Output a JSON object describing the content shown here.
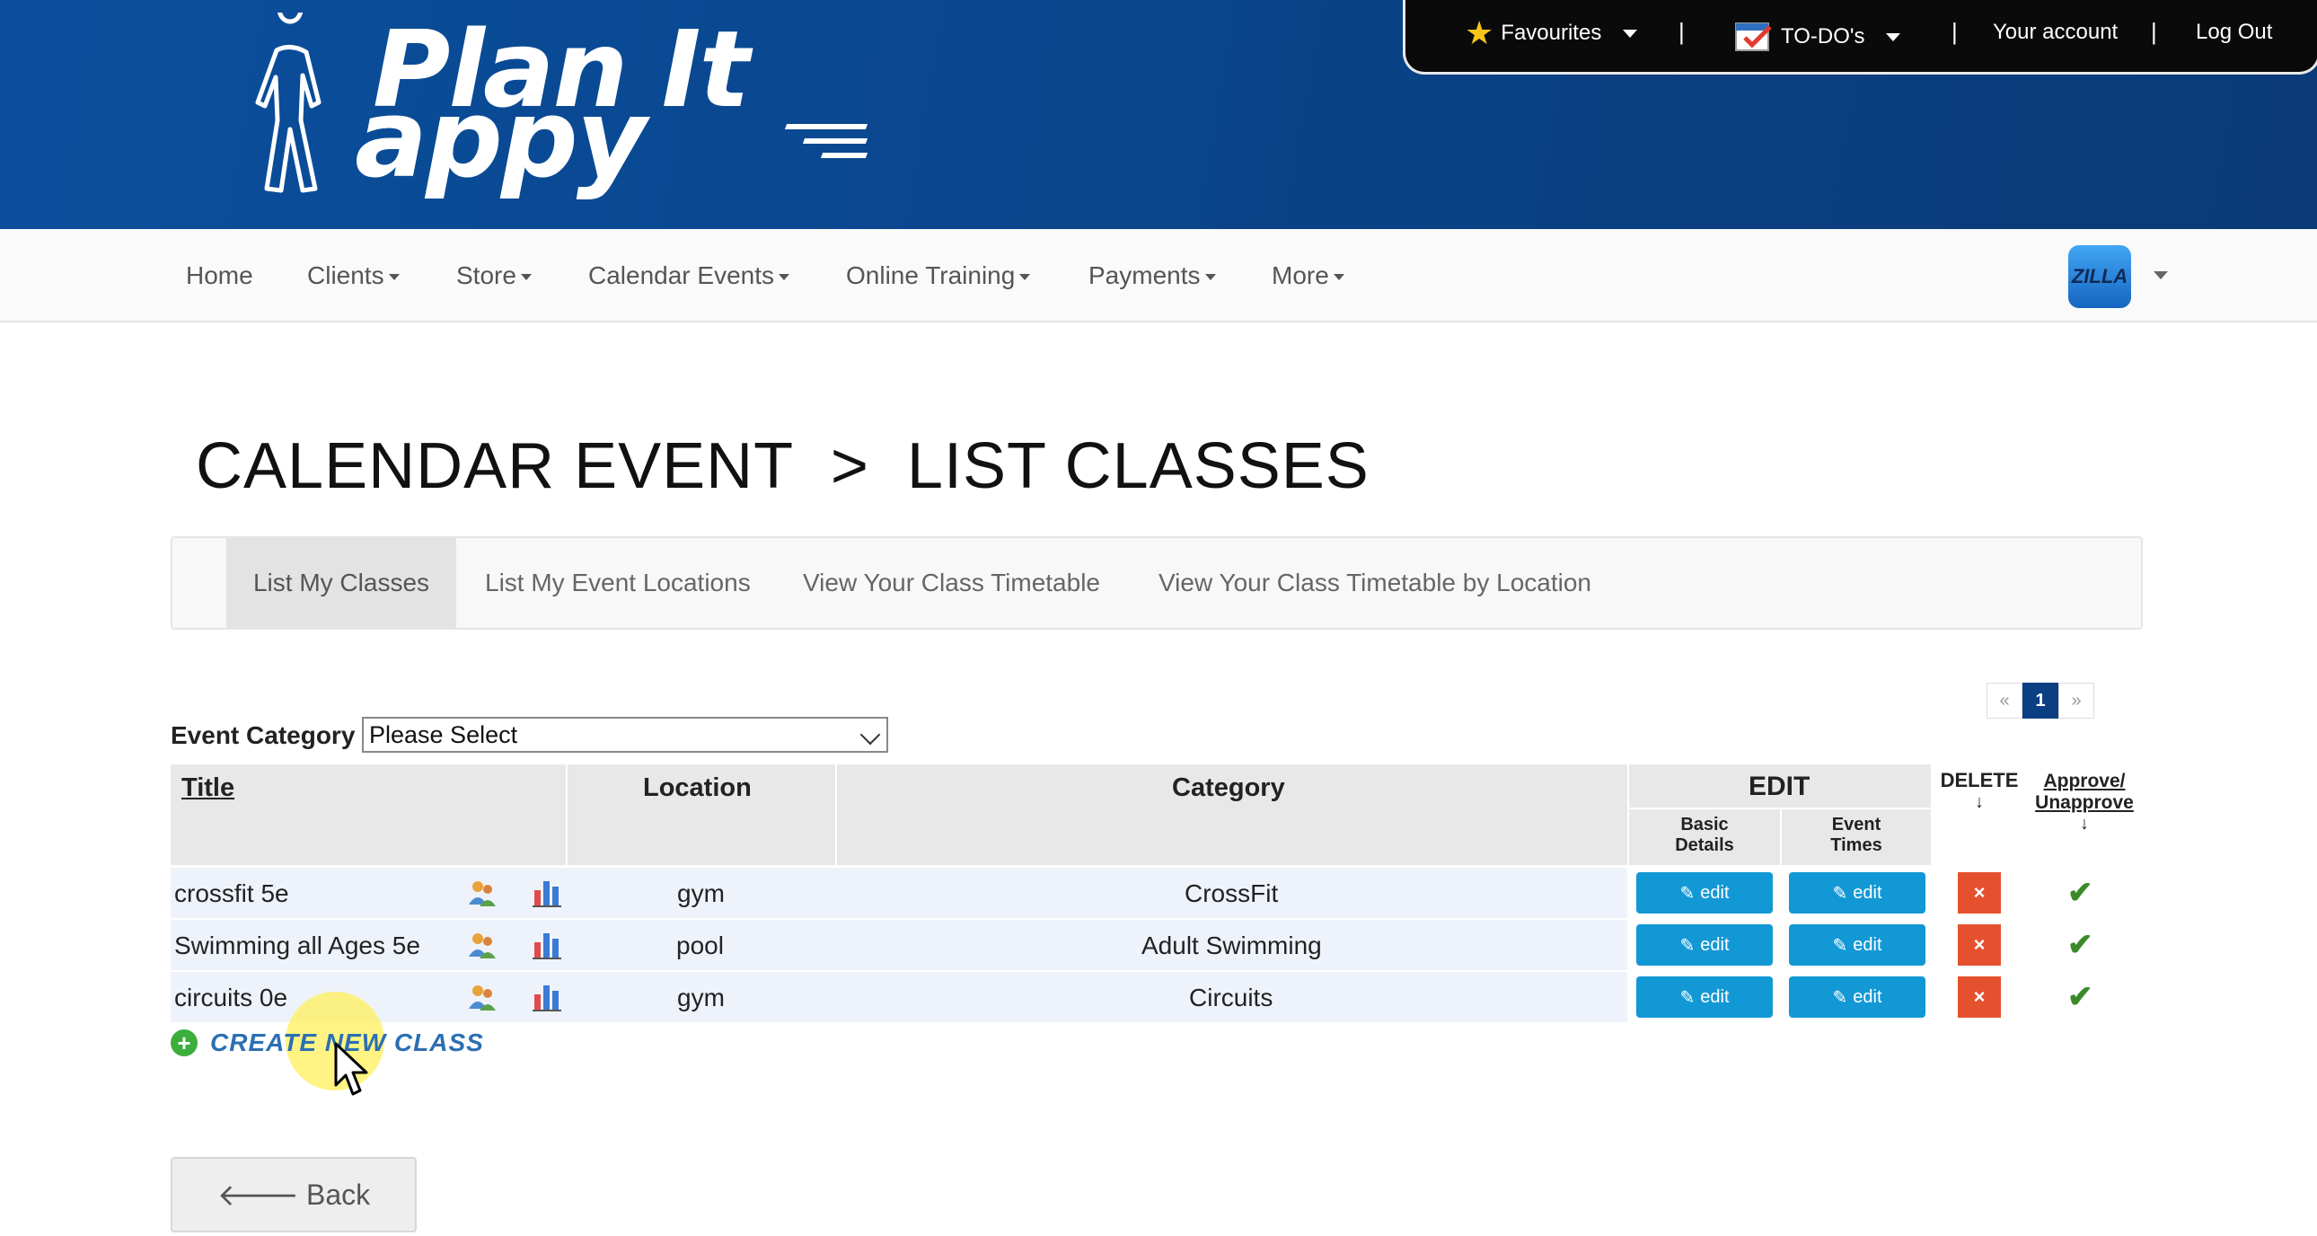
{
  "brand": {
    "logo_line1": "Plan It",
    "logo_line2": "appy"
  },
  "topbar": {
    "favourites": "Favourites",
    "todos": "TO-DO's",
    "account": "Your account",
    "logout": "Log Out",
    "separator": "|"
  },
  "nav": {
    "items": [
      "Home",
      "Clients",
      "Store",
      "Calendar Events",
      "Online Training",
      "Payments",
      "More"
    ],
    "avatar_text": "ZILLA"
  },
  "page": {
    "title": "CALENDAR EVENT  >  LIST CLASSES"
  },
  "tabs": [
    "List My Classes",
    "List My Event Locations",
    "View Your Class Timetable",
    "View Your Class Timetable by Location"
  ],
  "pagination": {
    "prev": "«",
    "current": "1",
    "next": "»"
  },
  "filter": {
    "label": "Event Category",
    "value": "Please Select"
  },
  "table": {
    "headers": {
      "title": "Title",
      "location": "Location",
      "category": "Category",
      "edit": "EDIT",
      "basic_details_1": "Basic",
      "basic_details_2": "Details",
      "event_times_1": "Event",
      "event_times_2": "Times",
      "delete": "DELETE",
      "delete_arrow": "↓",
      "approve_1": "Approve/",
      "approve_2": "Unapprove",
      "approve_arrow": "↓"
    },
    "rows": [
      {
        "title": "crossfit 5e",
        "location": "gym",
        "category": "CrossFit"
      },
      {
        "title": "Swimming all Ages 5e",
        "location": "pool",
        "category": "Adult Swimming"
      },
      {
        "title": "circuits 0e",
        "location": "gym",
        "category": "Circuits"
      }
    ],
    "edit_label": "edit",
    "delete_symbol": "×",
    "approved_symbol": "✔"
  },
  "actions": {
    "create": "CREATE NEW CLASS",
    "back": "Back"
  },
  "colors": {
    "header_blue": "#0a4891",
    "edit_blue": "#1398d6",
    "delete_red": "#e5512e",
    "approve_green": "#3a8a2a"
  }
}
